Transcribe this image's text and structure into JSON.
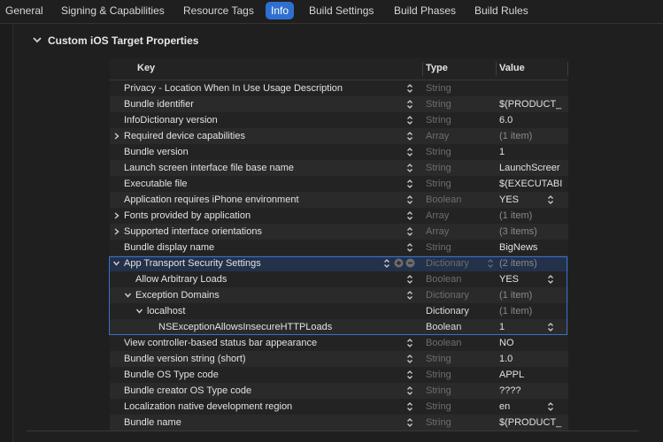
{
  "tabs": [
    {
      "label": "General"
    },
    {
      "label": "Signing & Capabilities"
    },
    {
      "label": "Resource Tags"
    },
    {
      "label": "Info"
    },
    {
      "label": "Build Settings"
    },
    {
      "label": "Build Phases"
    },
    {
      "label": "Build Rules"
    }
  ],
  "section": {
    "title": "Custom iOS Target Properties"
  },
  "columns": {
    "key": "Key",
    "type": "Type",
    "value": "Value"
  },
  "rows": [
    {
      "key": "Privacy - Location When In Use Usage Description",
      "type": "String",
      "value": ""
    },
    {
      "key": "Bundle identifier",
      "type": "String",
      "value": "$(PRODUCT_"
    },
    {
      "key": "InfoDictionary version",
      "type": "String",
      "value": "6.0"
    },
    {
      "key": "Required device capabilities",
      "type": "Array",
      "value": "(1 item)"
    },
    {
      "key": "Bundle version",
      "type": "String",
      "value": "1"
    },
    {
      "key": "Launch screen interface file base name",
      "type": "String",
      "value": "LaunchScreer"
    },
    {
      "key": "Executable file",
      "type": "String",
      "value": "$(EXECUTABI"
    },
    {
      "key": "Application requires iPhone environment",
      "type": "Boolean",
      "value": "YES"
    },
    {
      "key": "Fonts provided by application",
      "type": "Array",
      "value": "(1 item)"
    },
    {
      "key": "Supported interface orientations",
      "type": "Array",
      "value": "(3 items)"
    },
    {
      "key": "Bundle display name",
      "type": "String",
      "value": "BigNews"
    },
    {
      "key": "App Transport Security Settings",
      "type": "Dictionary",
      "value": "(2 items)"
    },
    {
      "key": "Allow Arbitrary Loads",
      "type": "Boolean",
      "value": "YES"
    },
    {
      "key": "Exception Domains",
      "type": "Dictionary",
      "value": "(1 item)"
    },
    {
      "key": "localhost",
      "type": "Dictionary",
      "value": "(1 item)"
    },
    {
      "key": "NSExceptionAllowsInsecureHTTPLoads",
      "type": "Boolean",
      "value": "1"
    },
    {
      "key": "View controller-based status bar appearance",
      "type": "Boolean",
      "value": "NO"
    },
    {
      "key": "Bundle version string (short)",
      "type": "String",
      "value": "1.0"
    },
    {
      "key": "Bundle OS Type code",
      "type": "String",
      "value": "APPL"
    },
    {
      "key": "Bundle creator OS Type code",
      "type": "String",
      "value": "????"
    },
    {
      "key": "Localization native development region",
      "type": "String",
      "value": "en"
    },
    {
      "key": "Bundle name",
      "type": "String",
      "value": "$(PRODUCT_"
    }
  ]
}
